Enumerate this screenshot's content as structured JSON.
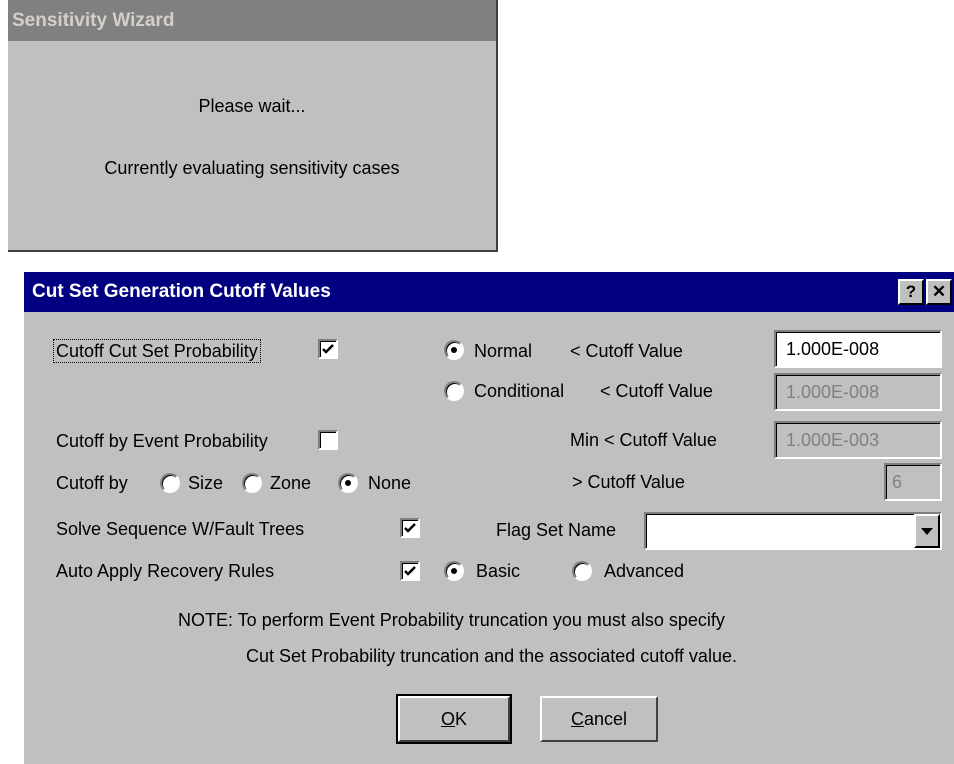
{
  "wizard": {
    "title": "Sensitivity Wizard",
    "line1": "Please wait...",
    "line2": "Currently evaluating sensitivity cases"
  },
  "dialog": {
    "title": "Cut Set Generation Cutoff Values",
    "help_icon": "help-icon",
    "close_icon": "close-icon",
    "cutset_prob_label": "Cutoff Cut Set Probability",
    "cutset_prob_checked": true,
    "normal_label": "Normal",
    "normal_selected": true,
    "normal_cutoff_label": "< Cutoff Value",
    "normal_cutoff_value": "1.000E-008",
    "conditional_label": "Conditional",
    "conditional_selected": false,
    "conditional_cutoff_label": "< Cutoff Value",
    "conditional_cutoff_value": "1.000E-008",
    "event_prob_label": "Cutoff by Event Probability",
    "event_prob_checked": false,
    "min_cutoff_label": "Min < Cutoff Value",
    "min_cutoff_value": "1.000E-003",
    "cutoff_by_label": "Cutoff by",
    "cutoff_by_options": [
      "Size",
      "Zone",
      "None"
    ],
    "cutoff_by_selected": "None",
    "gt_cutoff_label": "> Cutoff Value",
    "gt_cutoff_value": "6",
    "solve_seq_label": "Solve Sequence W/Fault Trees",
    "solve_seq_checked": true,
    "flag_set_label": "Flag Set Name",
    "flag_set_value": "",
    "auto_apply_label": "Auto Apply Recovery Rules",
    "auto_apply_checked": true,
    "basic_label": "Basic",
    "advanced_label": "Advanced",
    "recovery_selected": "Basic",
    "note_line1": "NOTE: To perform Event Probability truncation you must also specify",
    "note_line2": "Cut Set Probability truncation and the associated cutoff value.",
    "ok_accel": "O",
    "ok_rest": "K",
    "cancel_accel": "C",
    "cancel_rest": "ancel"
  },
  "colors": {
    "face": "#c0c0c0",
    "title_active": "#000080",
    "title_inactive": "#808080"
  }
}
